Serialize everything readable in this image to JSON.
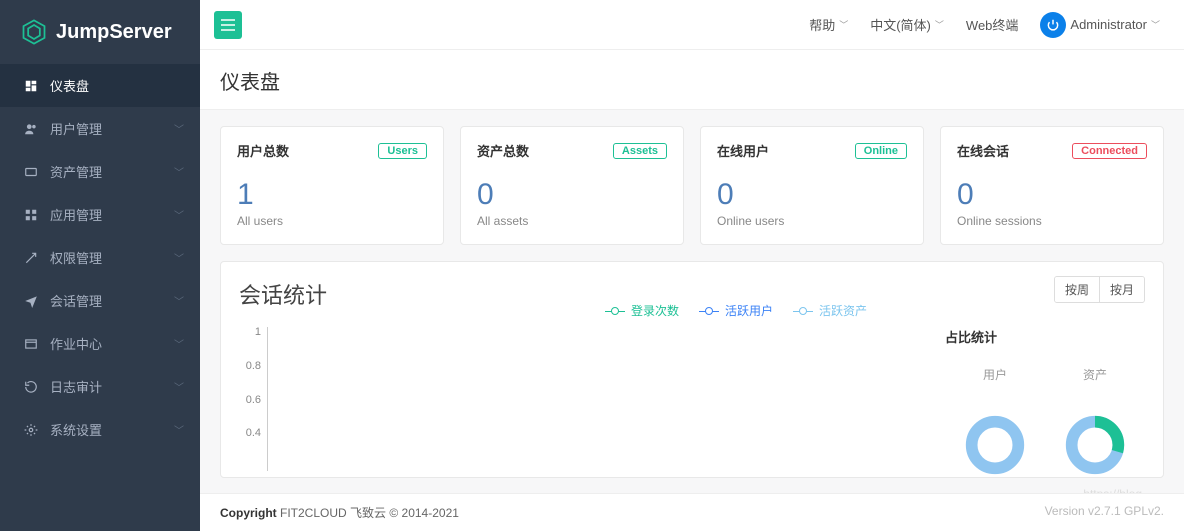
{
  "brand": "JumpServer",
  "topbar": {
    "help": "帮助",
    "lang": "中文(简体)",
    "webterm": "Web终端",
    "user": "Administrator"
  },
  "sidebar": {
    "items": [
      {
        "label": "仪表盘",
        "icon": "dashboard",
        "active": true,
        "expandable": false
      },
      {
        "label": "用户管理",
        "icon": "users",
        "expandable": true
      },
      {
        "label": "资产管理",
        "icon": "assets",
        "expandable": true
      },
      {
        "label": "应用管理",
        "icon": "apps",
        "expandable": true
      },
      {
        "label": "权限管理",
        "icon": "perm",
        "expandable": true
      },
      {
        "label": "会话管理",
        "icon": "session",
        "expandable": true
      },
      {
        "label": "作业中心",
        "icon": "jobs",
        "expandable": true
      },
      {
        "label": "日志审计",
        "icon": "audit",
        "expandable": true
      },
      {
        "label": "系统设置",
        "icon": "settings",
        "expandable": true
      }
    ]
  },
  "page_title": "仪表盘",
  "cards": [
    {
      "title": "用户总数",
      "tag": "Users",
      "tag_class": "users",
      "value": "1",
      "sub": "All users"
    },
    {
      "title": "资产总数",
      "tag": "Assets",
      "tag_class": "assets",
      "value": "0",
      "sub": "All assets"
    },
    {
      "title": "在线用户",
      "tag": "Online",
      "tag_class": "online",
      "value": "0",
      "sub": "Online users"
    },
    {
      "title": "在线会话",
      "tag": "Connected",
      "tag_class": "connected",
      "value": "0",
      "sub": "Online sessions"
    }
  ],
  "panel": {
    "title": "会话统计",
    "legend": [
      "登录次数",
      "活跃用户",
      "活跃资产"
    ],
    "switch": [
      "按周",
      "按月"
    ],
    "side_title": "占比统计",
    "side_labels": [
      "用户",
      "资产"
    ]
  },
  "chart_data": {
    "type": "line",
    "series": [
      {
        "name": "登录次数",
        "values": []
      },
      {
        "name": "活跃用户",
        "values": []
      },
      {
        "name": "活跃资产",
        "values": []
      }
    ],
    "y_ticks": [
      1,
      0.8,
      0.6,
      0.4
    ],
    "ylim": [
      0,
      1
    ],
    "xlabel": "",
    "ylabel": "",
    "title": "会话统计"
  },
  "donuts": {
    "user": {
      "type": "pie",
      "values": [
        100
      ],
      "colors": [
        "#8fc5f0"
      ]
    },
    "asset": {
      "type": "pie",
      "values": [
        70,
        30
      ],
      "colors": [
        "#8fc5f0",
        "#1dc095"
      ]
    }
  },
  "footer": {
    "copyright_bold": "Copyright",
    "copyright_text": "FIT2CLOUD 飞致云 © 2014-2021",
    "version": "Version v2.7.1 GPLv2."
  },
  "watermark": "https://blog…"
}
